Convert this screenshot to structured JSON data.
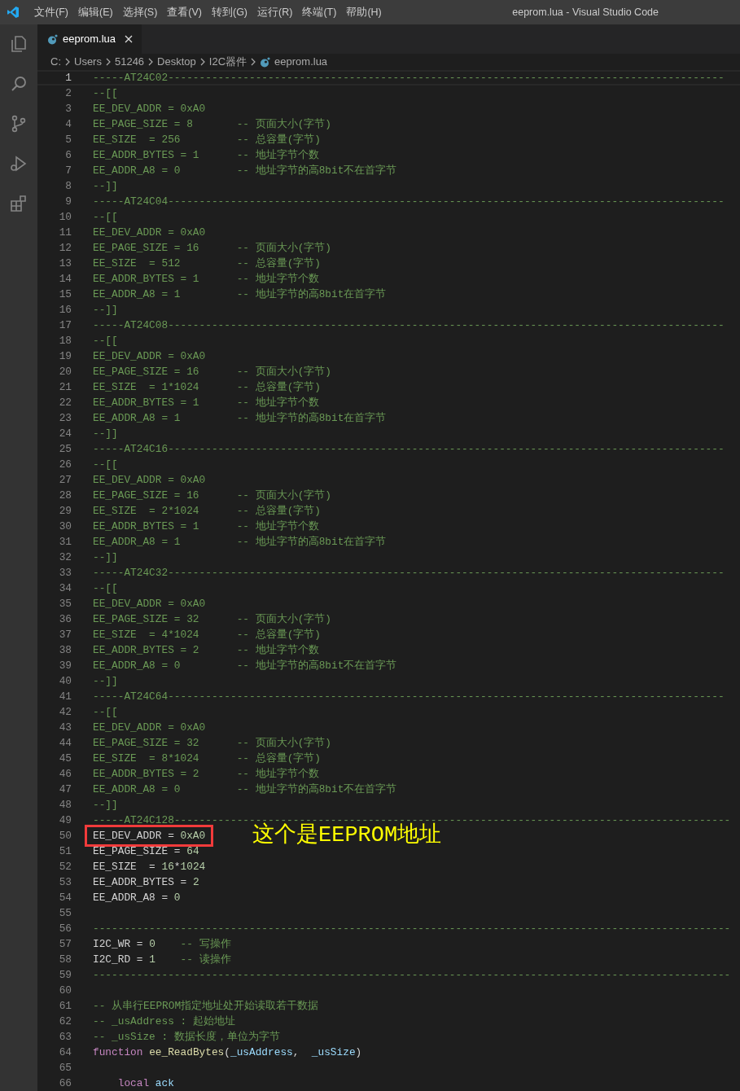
{
  "window": {
    "title": "eeprom.lua - Visual Studio Code"
  },
  "menu": [
    "文件(F)",
    "编辑(E)",
    "选择(S)",
    "查看(V)",
    "转到(G)",
    "运行(R)",
    "终端(T)",
    "帮助(H)"
  ],
  "activity_bar": [
    {
      "kind": "files",
      "selected": false
    },
    {
      "kind": "search",
      "selected": false
    },
    {
      "kind": "source-control",
      "selected": false
    },
    {
      "kind": "run",
      "selected": false
    },
    {
      "kind": "extensions",
      "selected": false
    }
  ],
  "tabs": [
    {
      "label": "eeprom.lua",
      "selected": true
    }
  ],
  "breadcrumbs": [
    "C:",
    "Users",
    "51246",
    "Desktop",
    "I2C器件",
    "eeprom.lua"
  ],
  "editor": {
    "lines": [
      {
        "no": "1",
        "current": true,
        "tokens": [
          {
            "kind": "comment",
            "text": "-----AT24C02-----------------------------------------------------------------------------------------"
          }
        ]
      },
      {
        "no": "2",
        "current": false,
        "tokens": [
          {
            "kind": "comment",
            "text": "--[["
          }
        ]
      },
      {
        "no": "3",
        "current": false,
        "tokens": [
          {
            "kind": "comment",
            "text": "EE_DEV_ADDR = 0xA0"
          }
        ]
      },
      {
        "no": "4",
        "current": false,
        "tokens": [
          {
            "kind": "comment",
            "text": "EE_PAGE_SIZE = 8       -- 页面大小(字节)"
          }
        ]
      },
      {
        "no": "5",
        "current": false,
        "tokens": [
          {
            "kind": "comment",
            "text": "EE_SIZE  = 256         -- 总容量(字节)"
          }
        ]
      },
      {
        "no": "6",
        "current": false,
        "tokens": [
          {
            "kind": "comment",
            "text": "EE_ADDR_BYTES = 1      -- 地址字节个数"
          }
        ]
      },
      {
        "no": "7",
        "current": false,
        "tokens": [
          {
            "kind": "comment",
            "text": "EE_ADDR_A8 = 0         -- 地址字节的高8bit不在首字节"
          }
        ]
      },
      {
        "no": "8",
        "current": false,
        "tokens": [
          {
            "kind": "comment",
            "text": "--]]"
          }
        ]
      },
      {
        "no": "9",
        "current": false,
        "tokens": [
          {
            "kind": "comment",
            "text": "-----AT24C04-----------------------------------------------------------------------------------------"
          }
        ]
      },
      {
        "no": "10",
        "current": false,
        "tokens": [
          {
            "kind": "comment",
            "text": "--[["
          }
        ]
      },
      {
        "no": "11",
        "current": false,
        "tokens": [
          {
            "kind": "comment",
            "text": "EE_DEV_ADDR = 0xA0"
          }
        ]
      },
      {
        "no": "12",
        "current": false,
        "tokens": [
          {
            "kind": "comment",
            "text": "EE_PAGE_SIZE = 16      -- 页面大小(字节)"
          }
        ]
      },
      {
        "no": "13",
        "current": false,
        "tokens": [
          {
            "kind": "comment",
            "text": "EE_SIZE  = 512         -- 总容量(字节)"
          }
        ]
      },
      {
        "no": "14",
        "current": false,
        "tokens": [
          {
            "kind": "comment",
            "text": "EE_ADDR_BYTES = 1      -- 地址字节个数"
          }
        ]
      },
      {
        "no": "15",
        "current": false,
        "tokens": [
          {
            "kind": "comment",
            "text": "EE_ADDR_A8 = 1         -- 地址字节的高8bit在首字节"
          }
        ]
      },
      {
        "no": "16",
        "current": false,
        "tokens": [
          {
            "kind": "comment",
            "text": "--]]"
          }
        ]
      },
      {
        "no": "17",
        "current": false,
        "tokens": [
          {
            "kind": "comment",
            "text": "-----AT24C08-----------------------------------------------------------------------------------------"
          }
        ]
      },
      {
        "no": "18",
        "current": false,
        "tokens": [
          {
            "kind": "comment",
            "text": "--[["
          }
        ]
      },
      {
        "no": "19",
        "current": false,
        "tokens": [
          {
            "kind": "comment",
            "text": "EE_DEV_ADDR = 0xA0"
          }
        ]
      },
      {
        "no": "20",
        "current": false,
        "tokens": [
          {
            "kind": "comment",
            "text": "EE_PAGE_SIZE = 16      -- 页面大小(字节)"
          }
        ]
      },
      {
        "no": "21",
        "current": false,
        "tokens": [
          {
            "kind": "comment",
            "text": "EE_SIZE  = 1*1024      -- 总容量(字节)"
          }
        ]
      },
      {
        "no": "22",
        "current": false,
        "tokens": [
          {
            "kind": "comment",
            "text": "EE_ADDR_BYTES = 1      -- 地址字节个数"
          }
        ]
      },
      {
        "no": "23",
        "current": false,
        "tokens": [
          {
            "kind": "comment",
            "text": "EE_ADDR_A8 = 1         -- 地址字节的高8bit在首字节"
          }
        ]
      },
      {
        "no": "24",
        "current": false,
        "tokens": [
          {
            "kind": "comment",
            "text": "--]]"
          }
        ]
      },
      {
        "no": "25",
        "current": false,
        "tokens": [
          {
            "kind": "comment",
            "text": "-----AT24C16-----------------------------------------------------------------------------------------"
          }
        ]
      },
      {
        "no": "26",
        "current": false,
        "tokens": [
          {
            "kind": "comment",
            "text": "--[["
          }
        ]
      },
      {
        "no": "27",
        "current": false,
        "tokens": [
          {
            "kind": "comment",
            "text": "EE_DEV_ADDR = 0xA0"
          }
        ]
      },
      {
        "no": "28",
        "current": false,
        "tokens": [
          {
            "kind": "comment",
            "text": "EE_PAGE_SIZE = 16      -- 页面大小(字节)"
          }
        ]
      },
      {
        "no": "29",
        "current": false,
        "tokens": [
          {
            "kind": "comment",
            "text": "EE_SIZE  = 2*1024      -- 总容量(字节)"
          }
        ]
      },
      {
        "no": "30",
        "current": false,
        "tokens": [
          {
            "kind": "comment",
            "text": "EE_ADDR_BYTES = 1      -- 地址字节个数"
          }
        ]
      },
      {
        "no": "31",
        "current": false,
        "tokens": [
          {
            "kind": "comment",
            "text": "EE_ADDR_A8 = 1         -- 地址字节的高8bit在首字节"
          }
        ]
      },
      {
        "no": "32",
        "current": false,
        "tokens": [
          {
            "kind": "comment",
            "text": "--]]"
          }
        ]
      },
      {
        "no": "33",
        "current": false,
        "tokens": [
          {
            "kind": "comment",
            "text": "-----AT24C32-----------------------------------------------------------------------------------------"
          }
        ]
      },
      {
        "no": "34",
        "current": false,
        "tokens": [
          {
            "kind": "comment",
            "text": "--[["
          }
        ]
      },
      {
        "no": "35",
        "current": false,
        "tokens": [
          {
            "kind": "comment",
            "text": "EE_DEV_ADDR = 0xA0"
          }
        ]
      },
      {
        "no": "36",
        "current": false,
        "tokens": [
          {
            "kind": "comment",
            "text": "EE_PAGE_SIZE = 32      -- 页面大小(字节)"
          }
        ]
      },
      {
        "no": "37",
        "current": false,
        "tokens": [
          {
            "kind": "comment",
            "text": "EE_SIZE  = 4*1024      -- 总容量(字节)"
          }
        ]
      },
      {
        "no": "38",
        "current": false,
        "tokens": [
          {
            "kind": "comment",
            "text": "EE_ADDR_BYTES = 2      -- 地址字节个数"
          }
        ]
      },
      {
        "no": "39",
        "current": false,
        "tokens": [
          {
            "kind": "comment",
            "text": "EE_ADDR_A8 = 0         -- 地址字节的高8bit不在首字节"
          }
        ]
      },
      {
        "no": "40",
        "current": false,
        "tokens": [
          {
            "kind": "comment",
            "text": "--]]"
          }
        ]
      },
      {
        "no": "41",
        "current": false,
        "tokens": [
          {
            "kind": "comment",
            "text": "-----AT24C64-----------------------------------------------------------------------------------------"
          }
        ]
      },
      {
        "no": "42",
        "current": false,
        "tokens": [
          {
            "kind": "comment",
            "text": "--[["
          }
        ]
      },
      {
        "no": "43",
        "current": false,
        "tokens": [
          {
            "kind": "comment",
            "text": "EE_DEV_ADDR = 0xA0"
          }
        ]
      },
      {
        "no": "44",
        "current": false,
        "tokens": [
          {
            "kind": "comment",
            "text": "EE_PAGE_SIZE = 32      -- 页面大小(字节)"
          }
        ]
      },
      {
        "no": "45",
        "current": false,
        "tokens": [
          {
            "kind": "comment",
            "text": "EE_SIZE  = 8*1024      -- 总容量(字节)"
          }
        ]
      },
      {
        "no": "46",
        "current": false,
        "tokens": [
          {
            "kind": "comment",
            "text": "EE_ADDR_BYTES = 2      -- 地址字节个数"
          }
        ]
      },
      {
        "no": "47",
        "current": false,
        "tokens": [
          {
            "kind": "comment",
            "text": "EE_ADDR_A8 = 0         -- 地址字节的高8bit不在首字节"
          }
        ]
      },
      {
        "no": "48",
        "current": false,
        "tokens": [
          {
            "kind": "comment",
            "text": "--]]"
          }
        ]
      },
      {
        "no": "49",
        "current": false,
        "tokens": [
          {
            "kind": "comment",
            "text": "-----AT24C128-----------------------------------------------------------------------------------------"
          }
        ]
      },
      {
        "no": "50",
        "current": false,
        "tokens": [
          {
            "kind": "text",
            "text": "EE_DEV_ADDR = "
          },
          {
            "kind": "number",
            "text": "0xA0"
          }
        ],
        "annotation": {
          "text": "这个是EEPROM地址"
        }
      },
      {
        "no": "51",
        "current": false,
        "tokens": [
          {
            "kind": "text",
            "text": "EE_PAGE_SIZE = "
          },
          {
            "kind": "number",
            "text": "64"
          }
        ]
      },
      {
        "no": "52",
        "current": false,
        "tokens": [
          {
            "kind": "text",
            "text": "EE_SIZE  = "
          },
          {
            "kind": "number",
            "text": "16"
          },
          {
            "kind": "text",
            "text": "*"
          },
          {
            "kind": "number",
            "text": "1024"
          }
        ]
      },
      {
        "no": "53",
        "current": false,
        "tokens": [
          {
            "kind": "text",
            "text": "EE_ADDR_BYTES = "
          },
          {
            "kind": "number",
            "text": "2"
          }
        ]
      },
      {
        "no": "54",
        "current": false,
        "tokens": [
          {
            "kind": "text",
            "text": "EE_ADDR_A8 = "
          },
          {
            "kind": "number",
            "text": "0"
          }
        ]
      },
      {
        "no": "55",
        "current": false
      },
      {
        "no": "56",
        "current": false,
        "tokens": [
          {
            "kind": "comment",
            "text": "------------------------------------------------------------------------------------------------------"
          }
        ]
      },
      {
        "no": "57",
        "current": false,
        "tokens": [
          {
            "kind": "text",
            "text": "I2C_WR = "
          },
          {
            "kind": "number",
            "text": "0"
          },
          {
            "kind": "comment",
            "text": "    -- 写操作"
          }
        ]
      },
      {
        "no": "58",
        "current": false,
        "tokens": [
          {
            "kind": "text",
            "text": "I2C_RD = "
          },
          {
            "kind": "number",
            "text": "1"
          },
          {
            "kind": "comment",
            "text": "    -- 读操作"
          }
        ]
      },
      {
        "no": "59",
        "current": false,
        "tokens": [
          {
            "kind": "comment",
            "text": "------------------------------------------------------------------------------------------------------"
          }
        ]
      },
      {
        "no": "60",
        "current": false
      },
      {
        "no": "61",
        "current": false,
        "tokens": [
          {
            "kind": "comment",
            "text": "-- 从串行EEPROM指定地址处开始读取若干数据"
          }
        ]
      },
      {
        "no": "62",
        "current": false,
        "tokens": [
          {
            "kind": "comment",
            "text": "-- _usAddress : 起始地址"
          }
        ]
      },
      {
        "no": "63",
        "current": false,
        "tokens": [
          {
            "kind": "comment",
            "text": "-- _usSize : 数据长度，单位为字节"
          }
        ]
      },
      {
        "no": "64",
        "current": false,
        "tokens": [
          {
            "kind": "keyword",
            "text": "function "
          },
          {
            "kind": "function",
            "text": "ee_ReadBytes"
          },
          {
            "kind": "text",
            "text": "("
          },
          {
            "kind": "variable",
            "text": "_usAddress"
          },
          {
            "kind": "text",
            "text": ",  "
          },
          {
            "kind": "variable",
            "text": "_usSize"
          },
          {
            "kind": "text",
            "text": ")"
          }
        ]
      },
      {
        "no": "65",
        "current": false
      },
      {
        "no": "66",
        "current": false,
        "tokens": [
          {
            "kind": "keyword",
            "text": "    local "
          },
          {
            "kind": "variable",
            "text": "ack"
          }
        ]
      }
    ]
  }
}
